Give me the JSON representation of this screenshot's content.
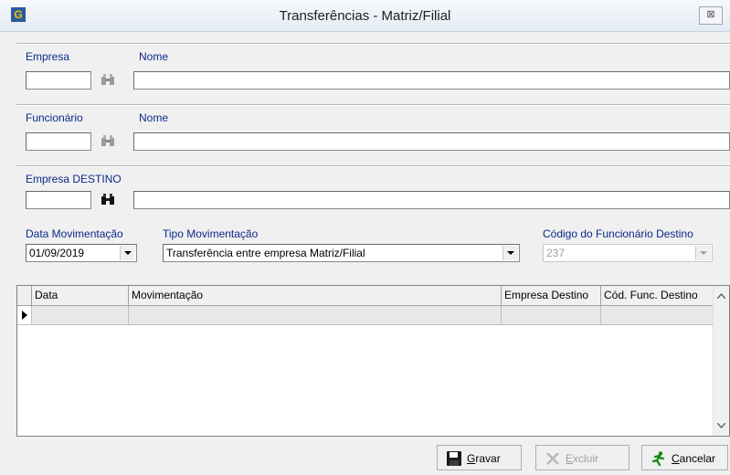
{
  "window": {
    "title": "Transferências - Matriz/Filial",
    "close_glyph": "⊠"
  },
  "empresa": {
    "label": "Empresa",
    "nome_label": "Nome",
    "code": "",
    "nome": ""
  },
  "funcionario": {
    "label": "Funcionário",
    "nome_label": "Nome",
    "code": "",
    "nome": ""
  },
  "destino": {
    "label": "Empresa DESTINO",
    "code": "",
    "nome": ""
  },
  "movimentacao": {
    "data_label": "Data Movimentação",
    "data_value": "01/09/2019",
    "tipo_label": "Tipo Movimentação",
    "tipo_value": "Transferência entre empresa Matriz/Filial",
    "codigo_label": "Código do Funcionário Destino",
    "codigo_value": "237"
  },
  "grid": {
    "columns": [
      "Data",
      "Movimentação",
      "Empresa Destino",
      "Cód. Func. Destino"
    ],
    "rows": [
      [
        "",
        "",
        "",
        ""
      ]
    ]
  },
  "buttons": {
    "gravar_accel": "G",
    "gravar_rest": "ravar",
    "excluir_accel": "E",
    "excluir_rest": "xcluir",
    "cancelar_accel": "C",
    "cancelar_rest": "ancelar"
  },
  "icons": {
    "app": "app-icon",
    "binoculars": "binoculars-icon",
    "save": "floppy-disk-icon",
    "delete": "delete-x-icon",
    "cancel": "running-man-icon"
  },
  "colors": {
    "label_blue": "#0a2a8a",
    "titlebar": "#e4ebf4"
  }
}
